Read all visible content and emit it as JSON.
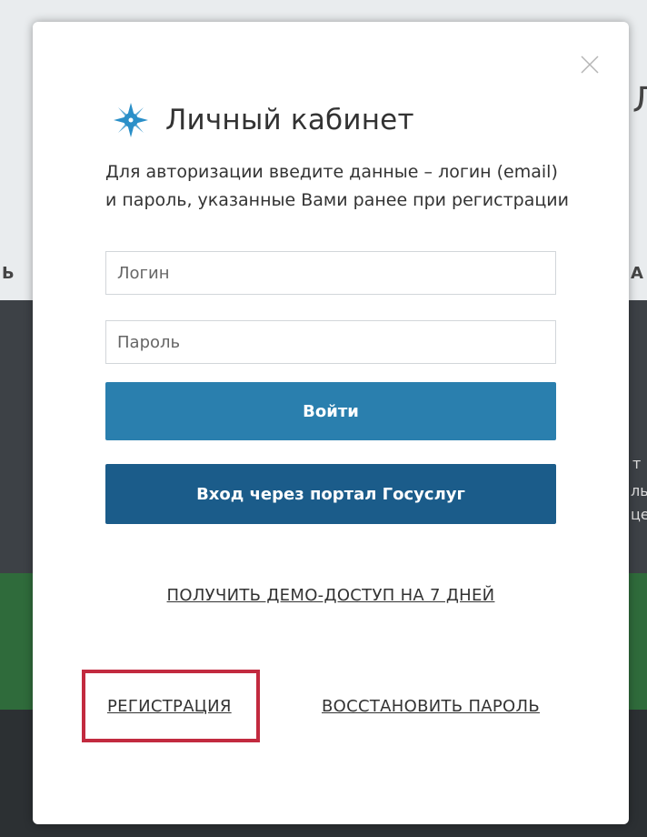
{
  "background": {
    "fragments": [
      "Л",
      "Ь",
      "А",
      "т",
      "ль",
      "це"
    ]
  },
  "modal": {
    "close_icon": "close-icon",
    "logo_icon": "compass-icon",
    "title": "Личный кабинет",
    "description": "Для авторизации введите данные – логин (email) и пароль, указанные Вами ранее при регистрации",
    "login_field": {
      "placeholder": "Логин",
      "value": ""
    },
    "password_field": {
      "placeholder": "Пароль",
      "value": ""
    },
    "login_button": "Войти",
    "gosuslugi_button": "Вход через портал Госуслуг",
    "demo_link": "ПОЛУЧИТЬ ДЕМО-ДОСТУП НА 7 ДНЕЙ",
    "register_link": "РЕГИСТРАЦИЯ",
    "restore_link": "ВОССТАНОВИТЬ ПАРОЛЬ"
  },
  "colors": {
    "login_button": "#2a7fae",
    "gosuslugi_button": "#1b5c8a",
    "highlight": "#c22a3f",
    "logo": "#2a8fc8"
  }
}
